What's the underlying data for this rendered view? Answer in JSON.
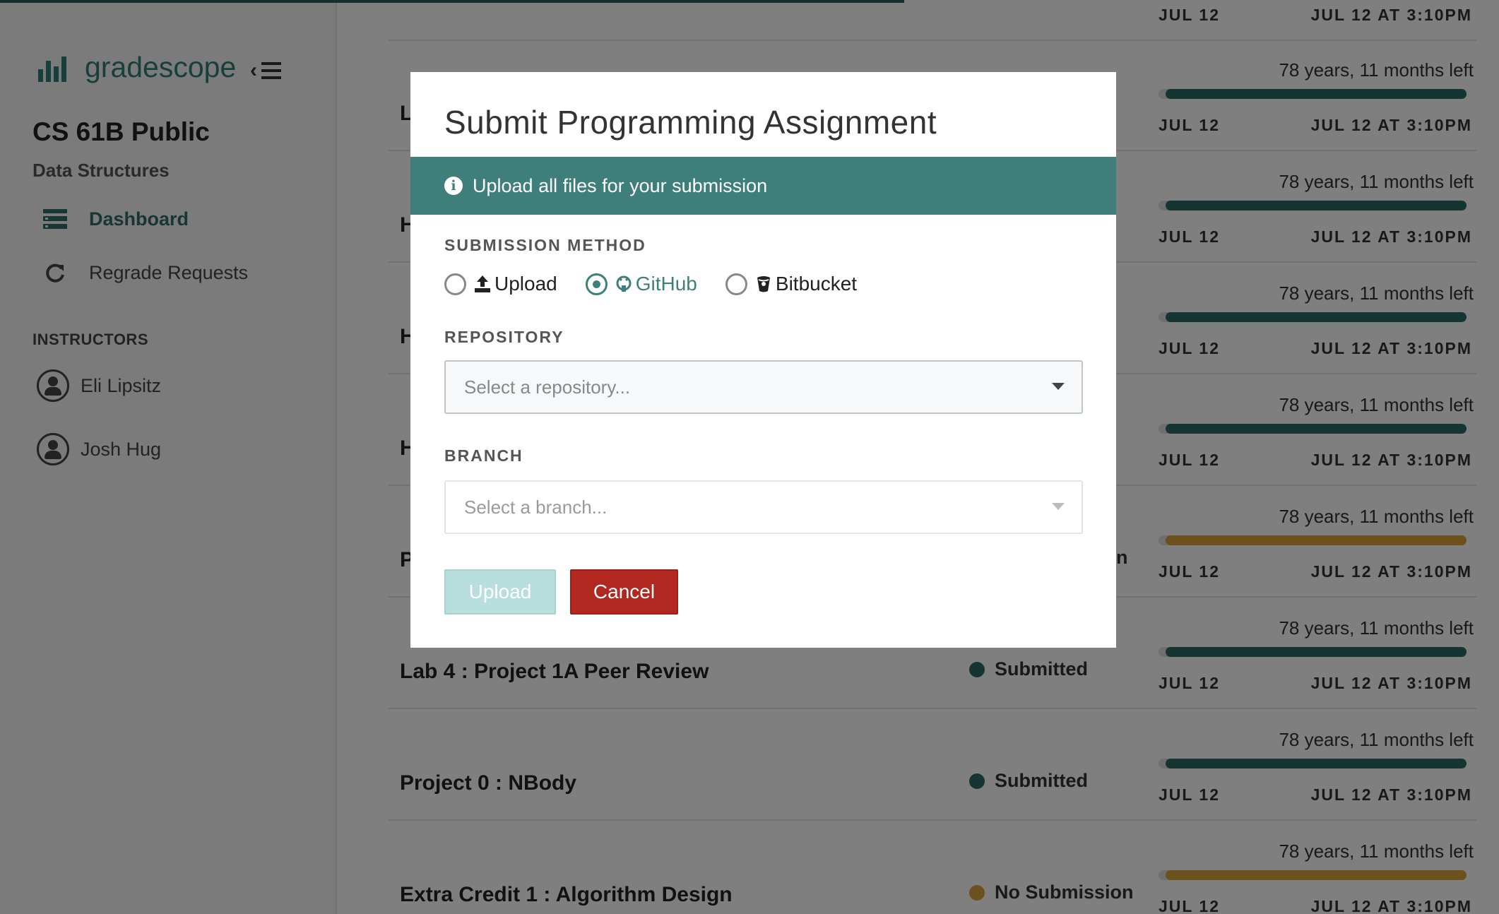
{
  "brand": {
    "name": "gradescope"
  },
  "course": {
    "title": "CS 61B Public",
    "subtitle": "Data Structures"
  },
  "nav": {
    "dashboard": "Dashboard",
    "regrade": "Regrade Requests"
  },
  "instructors": {
    "heading": "INSTRUCTORS",
    "people": [
      "Eli Lipsitz",
      "Josh Hug"
    ]
  },
  "rows": [
    {
      "name": "",
      "status": "",
      "time_left": "",
      "release": "JUL 12",
      "due": "JUL 12 AT 3:10PM",
      "bar_color": "#2b6a66",
      "progress": 1.0
    },
    {
      "name": "L",
      "status": "",
      "time_left": "78 years, 11 months left",
      "release": "JUL 12",
      "due": "JUL 12 AT 3:10PM",
      "bar_color": "#2b6a66",
      "progress": 1.0
    },
    {
      "name": "H",
      "status": "",
      "time_left": "78 years, 11 months left",
      "release": "JUL 12",
      "due": "JUL 12 AT 3:10PM",
      "bar_color": "#2b6a66",
      "progress": 1.0
    },
    {
      "name": "H",
      "status": "",
      "time_left": "78 years, 11 months left",
      "release": "JUL 12",
      "due": "JUL 12 AT 3:10PM",
      "bar_color": "#2b6a66",
      "progress": 1.0
    },
    {
      "name": "H",
      "status": "",
      "time_left": "78 years, 11 months left",
      "release": "JUL 12",
      "due": "JUL 12 AT 3:10PM",
      "bar_color": "#2b6a66",
      "progress": 1.0
    },
    {
      "name": "P",
      "status": "n",
      "time_left": "78 years, 11 months left",
      "release": "JUL 12",
      "due": "JUL 12 AT 3:10PM",
      "bar_color": "#d9a23a",
      "progress": 1.0
    },
    {
      "name": "Lab 4 : Project 1A Peer Review",
      "status": "Submitted",
      "status_color": "#2b6a66",
      "time_left": "78 years, 11 months left",
      "release": "JUL 12",
      "due": "JUL 12 AT 3:10PM",
      "bar_color": "#2b6a66",
      "progress": 1.0
    },
    {
      "name": "Project 0 : NBody",
      "status": "Submitted",
      "status_color": "#2b6a66",
      "time_left": "78 years, 11 months left",
      "release": "JUL 12",
      "due": "JUL 12 AT 3:10PM",
      "bar_color": "#2b6a66",
      "progress": 1.0
    },
    {
      "name": "Extra Credit 1 : Algorithm Design",
      "status": "No Submission",
      "status_color": "#d9a23a",
      "time_left": "78 years, 11 months left",
      "release": "JUL 12",
      "due": "JUL 12 AT 3:10PM",
      "bar_color": "#d9a23a",
      "progress": 1.0
    }
  ],
  "modal": {
    "title": "Submit Programming Assignment",
    "info": "Upload all files for your submission",
    "method_label": "SUBMISSION METHOD",
    "methods": [
      {
        "label": "Upload",
        "icon": "upload-icon",
        "checked": false
      },
      {
        "label": "GitHub",
        "icon": "github-icon",
        "checked": true
      },
      {
        "label": "Bitbucket",
        "icon": "bitbucket-icon",
        "checked": false
      }
    ],
    "repo_label": "REPOSITORY",
    "repo_placeholder": "Select a repository...",
    "branch_label": "BRANCH",
    "branch_placeholder": "Select a branch...",
    "upload_button": "Upload",
    "cancel_button": "Cancel"
  },
  "colors": {
    "accent": "#3f7f7b",
    "danger": "#b2271f",
    "warning": "#d9a23a"
  }
}
